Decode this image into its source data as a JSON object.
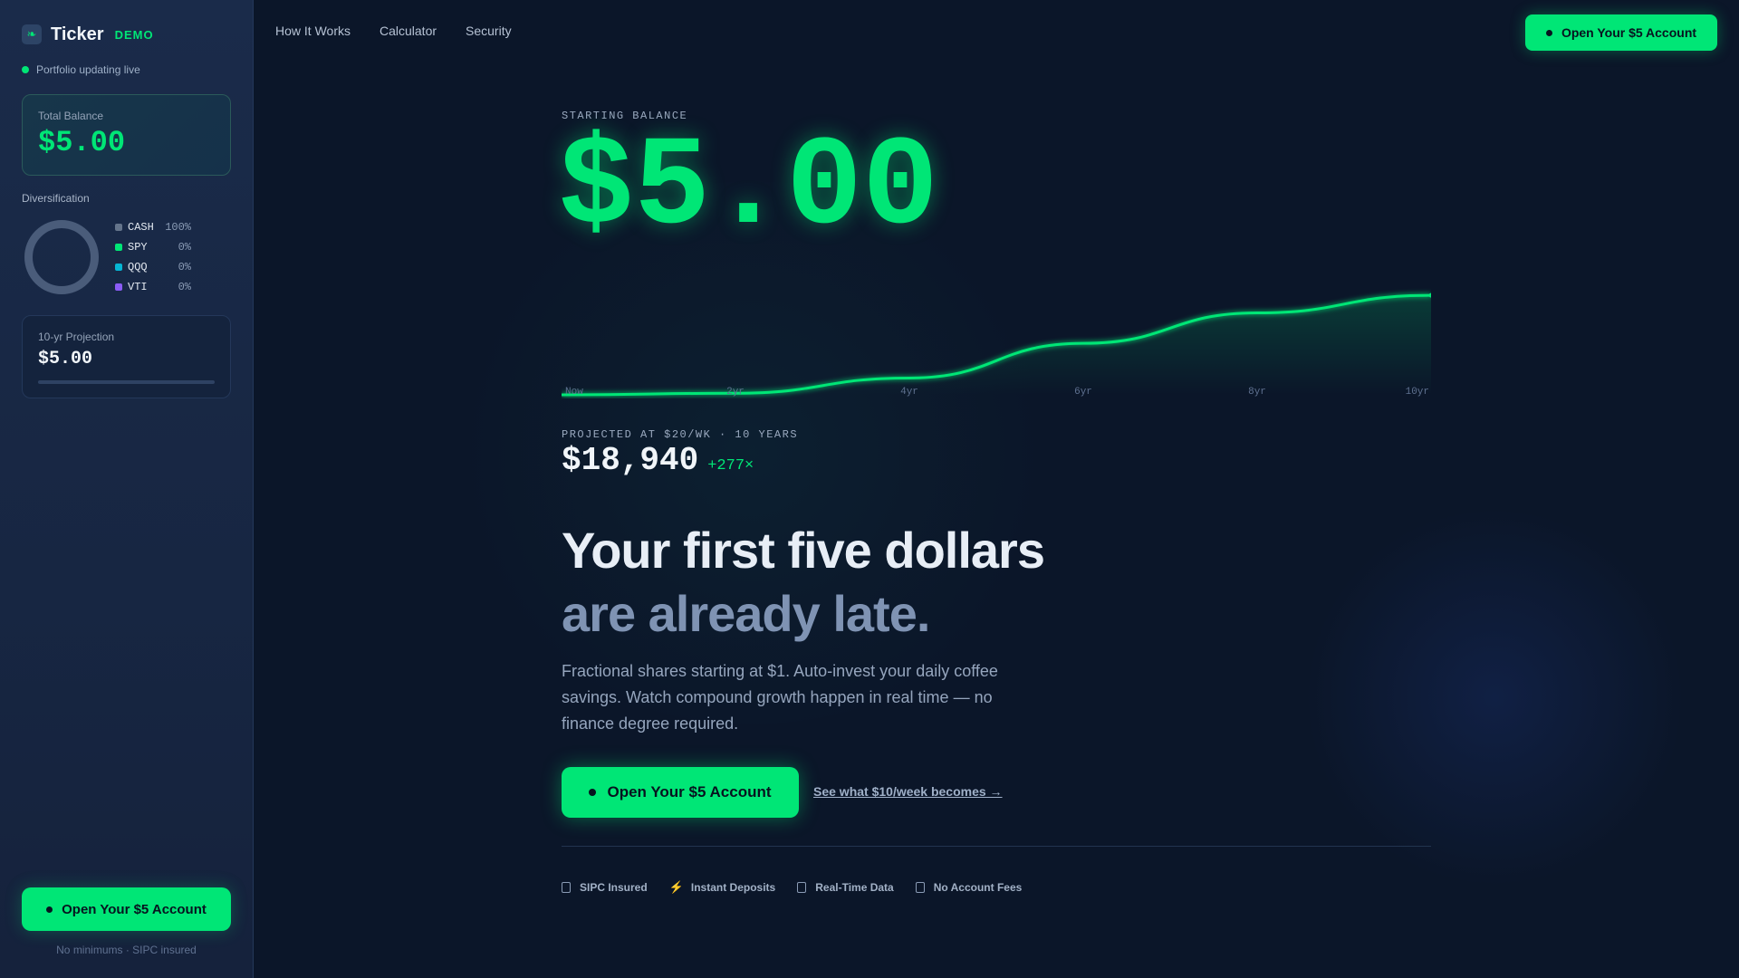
{
  "brand": {
    "name": "Ticker",
    "tag": "DEMO",
    "logo_icon": "leaf-icon"
  },
  "sidebar": {
    "live_status": "Portfolio updating live",
    "balance_label": "Total Balance",
    "balance_value": "$5.00",
    "diversification_title": "Diversification",
    "allocations": [
      {
        "ticker": "CASH",
        "pct": "100%",
        "color": "#64748b"
      },
      {
        "ticker": "SPY",
        "pct": "0%",
        "color": "#00e676"
      },
      {
        "ticker": "QQQ",
        "pct": "0%",
        "color": "#06b6d4"
      },
      {
        "ticker": "VTI",
        "pct": "0%",
        "color": "#8b5cf6"
      }
    ],
    "projection_label": "10-yr Projection",
    "projection_value": "$5.00",
    "projection_progress": 0,
    "cta_label": "Open Your $5 Account",
    "cta_note": "No minimums · SIPC insured"
  },
  "nav": {
    "links": [
      "How It Works",
      "Calculator",
      "Security"
    ],
    "cta_label": "Open Your $5 Account"
  },
  "hero": {
    "starting_label": "STARTING BALANCE",
    "starting_value": "$5.00",
    "projection_label": "PROJECTED AT $20/WK · 10 YEARS",
    "projection_value": "$18,940",
    "projection_multiplier": "+277×",
    "headline_line1": "Your first five dollars",
    "headline_line2": "are already late.",
    "subtext": "Fractional shares starting at $1. Auto-invest your daily coffee savings. Watch compound growth happen in real time — no finance degree required.",
    "cta_label": "Open Your $5 Account",
    "secondary_link": "See what $10/week becomes →"
  },
  "chart_data": {
    "type": "area",
    "x": [
      "Now",
      "2yr",
      "4yr",
      "6yr",
      "8yr",
      "10yr"
    ],
    "categories": [
      "Now",
      "2yr",
      "4yr",
      "6yr",
      "8yr",
      "10yr"
    ],
    "values": [
      5,
      300,
      3200,
      9800,
      15600,
      18940
    ],
    "ylim": [
      0,
      20000
    ],
    "grid": false,
    "line_color": "#00e676"
  },
  "badges": [
    {
      "label": "SIPC Insured",
      "icon": "shield-icon"
    },
    {
      "label": "Instant Deposits",
      "icon": "lightning-icon"
    },
    {
      "label": "Real-Time Data",
      "icon": "chart-icon"
    },
    {
      "label": "No Account Fees",
      "icon": "tag-icon"
    }
  ]
}
